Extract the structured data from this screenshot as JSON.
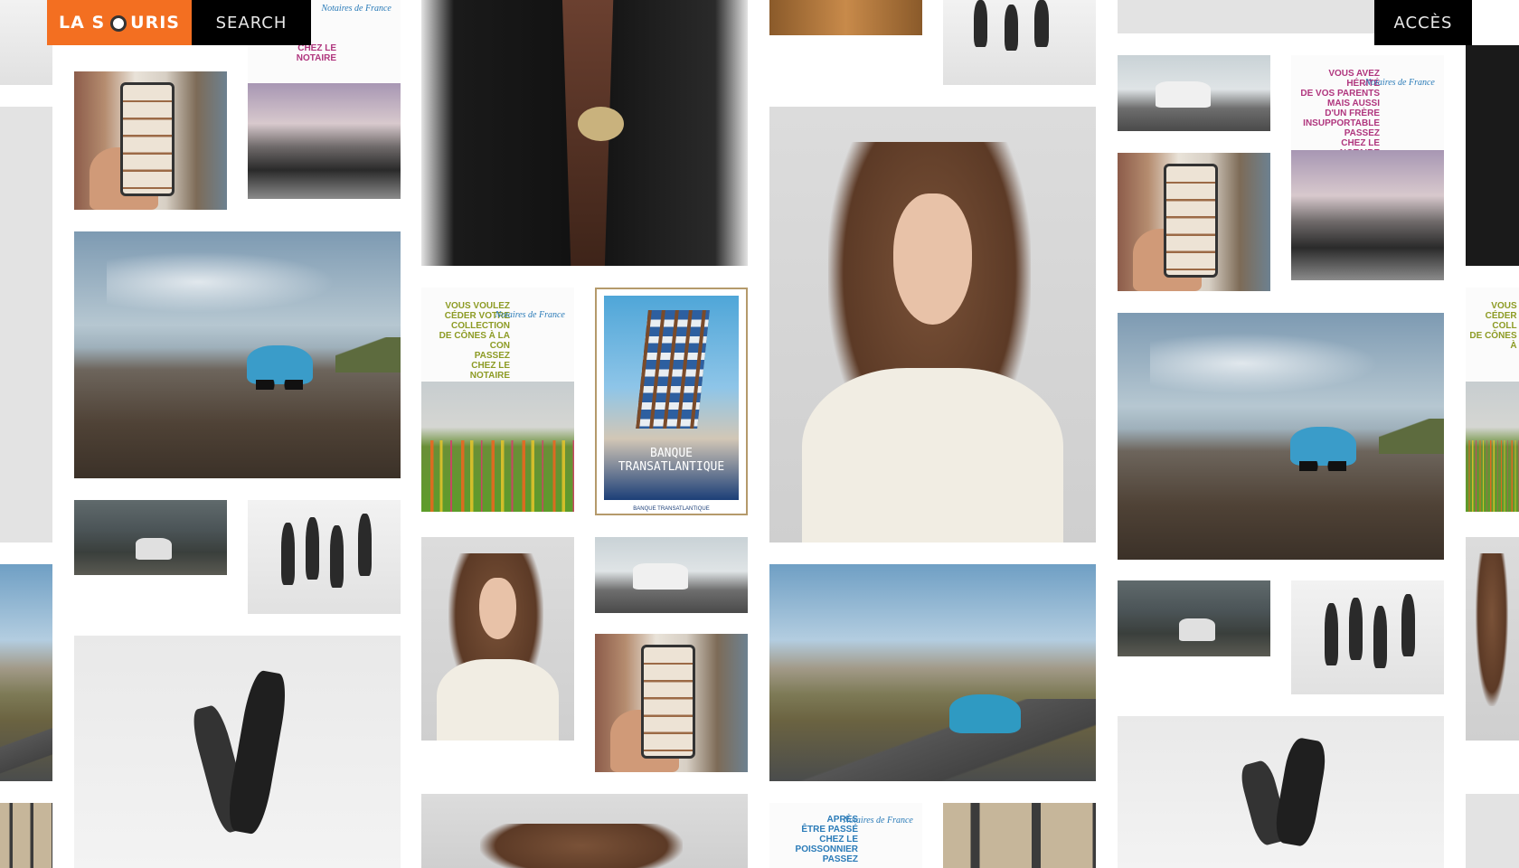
{
  "header": {
    "logo_left": "LA S",
    "logo_right": "URIS",
    "search_label": "SEARCH",
    "access_label": "ACCÈS"
  },
  "ads": {
    "notaire_brand": "Notaires de France",
    "heritage_text": "VOUS AVEZ HÉRITÉ\nDE VOS PARENTS\nMAIS AUSSI\nD'UN FRÈRE\nINSUPPORTABLE\nPASSEZ\nCHEZ LE NOTAIRE",
    "cones_text": "VOUS VOULEZ\nCÉDER VOTRE\nCOLLECTION\nDE CÔNES À LA CON\nPASSEZ\nCHEZ LE NOTAIRE",
    "fish_text": "APRÈS\nÊTRE PASSÉ\nCHEZ LE\nPOISSONNIER\nPASSEZ",
    "partial_top_text": "CHEZ LE NOTAIRE",
    "partial_right_text": "VOUS\nCÉDER\nCOLL\nDE CÔNES À"
  },
  "poster": {
    "title": "BANQUE TRANSATLANTIQUE",
    "footer": "BANQUE TRANSATLANTIQUE"
  }
}
